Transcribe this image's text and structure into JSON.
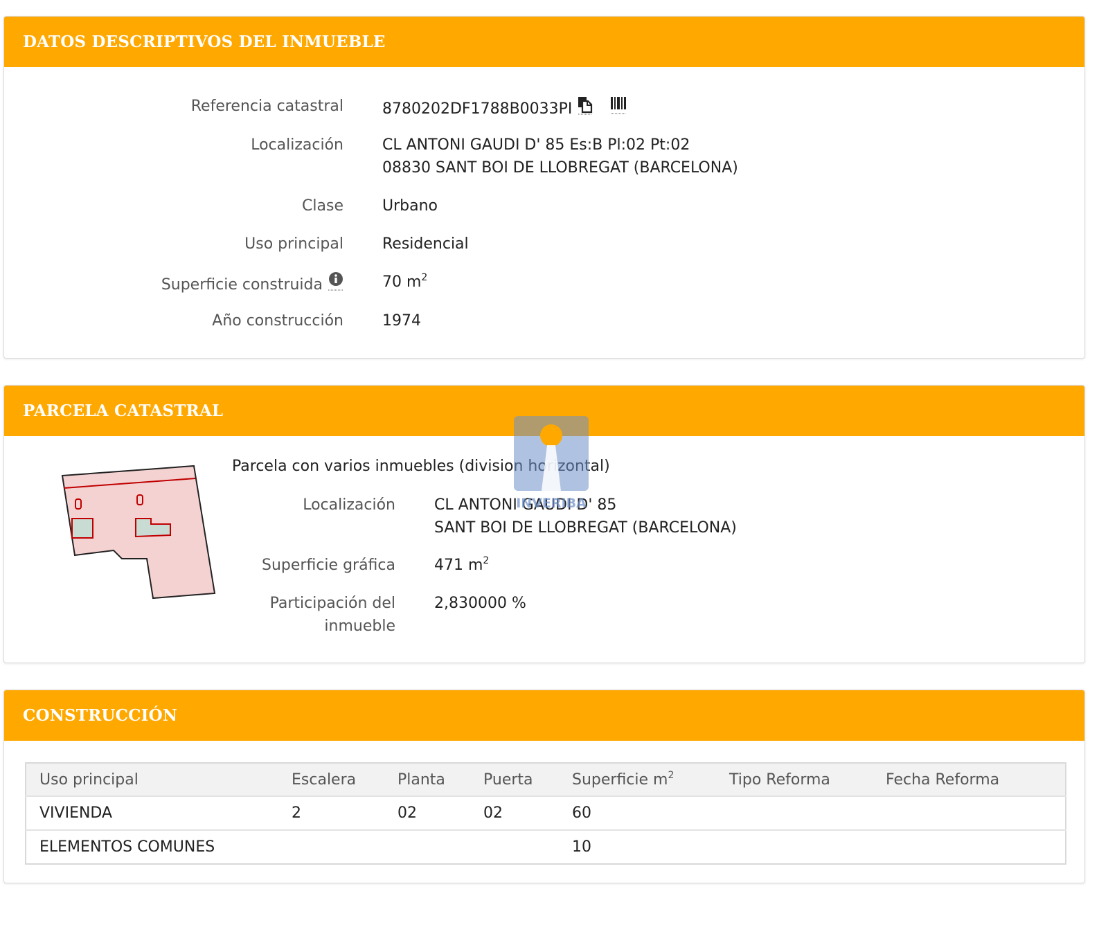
{
  "datos": {
    "title": "DATOS DESCRIPTIVOS DEL INMUEBLE",
    "ref_label": "Referencia catastral",
    "ref_value": "8780202DF1788B0033PI",
    "loc_label": "Localización",
    "loc_line1": "CL ANTONI GAUDI D' 85 Es:B Pl:02 Pt:02",
    "loc_line2": "08830 SANT BOI DE LLOBREGAT (BARCELONA)",
    "clase_label": "Clase",
    "clase_value": "Urbano",
    "uso_label": "Uso principal",
    "uso_value": "Residencial",
    "sup_label": "Superficie construida",
    "sup_value": "70 m",
    "sup_exp": "2",
    "anio_label": "Año construcción",
    "anio_value": "1974"
  },
  "parcela": {
    "title": "PARCELA CATASTRAL",
    "subtitle": "Parcela con varios inmuebles (division horizontal)",
    "loc_label": "Localización",
    "loc_line1": "CL ANTONI GAUDI D' 85",
    "loc_line2": "SANT BOI DE LLOBREGAT (BARCELONA)",
    "sup_label": "Superficie gráfica",
    "sup_value": "471 m",
    "sup_exp": "2",
    "part_label_1": "Participación del",
    "part_label_2": "inmueble",
    "part_value": "2,830000 %"
  },
  "construccion": {
    "title": "CONSTRUCCIÓN",
    "headers": {
      "uso": "Uso principal",
      "escalera": "Escalera",
      "planta": "Planta",
      "puerta": "Puerta",
      "superficie": "Superficie m",
      "superficie_exp": "2",
      "tipo": "Tipo Reforma",
      "fecha": "Fecha Reforma"
    },
    "rows": [
      {
        "uso": "VIVIENDA",
        "escalera": "2",
        "planta": "02",
        "puerta": "02",
        "superficie": "60",
        "tipo": "",
        "fecha": ""
      },
      {
        "uso": "ELEMENTOS COMUNES",
        "escalera": "",
        "planta": "",
        "puerta": "",
        "superficie": "10",
        "tipo": "",
        "fecha": ""
      }
    ]
  },
  "watermark": {
    "text": "INVERIBA"
  },
  "colors": {
    "header": "#ffa800",
    "parcel_fill": "#f4d2d2",
    "parcel_line": "#c00000",
    "building_fill": "#c9dcd3"
  },
  "icons": [
    "copy-icon",
    "barcode-icon",
    "info-icon",
    "parcel-map",
    "watermark-logo"
  ]
}
